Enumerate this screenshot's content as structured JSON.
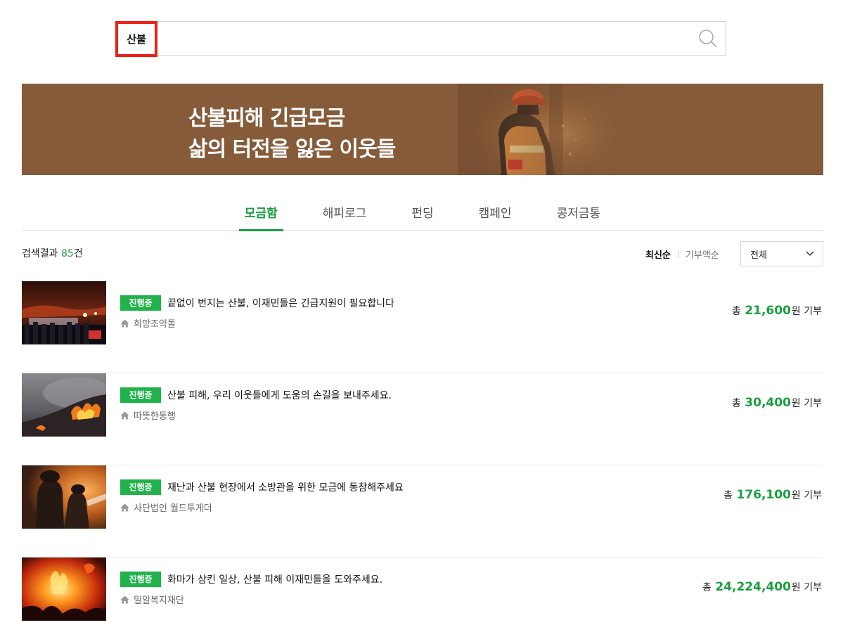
{
  "search": {
    "term": "산불",
    "placeholder": ""
  },
  "banner": {
    "line1": "산불피해 긴급모금",
    "line2": "삶의 터전을 잃은 이웃들"
  },
  "tabs": [
    {
      "label": "모금함",
      "active": true
    },
    {
      "label": "해피로그",
      "active": false
    },
    {
      "label": "펀딩",
      "active": false
    },
    {
      "label": "캠페인",
      "active": false
    },
    {
      "label": "콩저금통",
      "active": false
    }
  ],
  "results": {
    "prefix": "검색결과 ",
    "count": "85",
    "suffix": "건"
  },
  "sort": {
    "latest": "최신순",
    "by_donation": "기부액순"
  },
  "filter": {
    "selected": "전체"
  },
  "items": [
    {
      "status": "진행중",
      "title": "끝없이 번지는 산불, 이재민들은 긴급지원이 필요합니다",
      "org": "희망조약돌",
      "amount_prefix": "총 ",
      "amount": "21,600",
      "amount_suffix": "원 기부"
    },
    {
      "status": "진행중",
      "title": "산불 피해, 우리 이웃들에게 도움의 손길을 보내주세요.",
      "org": "따뜻한동행",
      "amount_prefix": "총 ",
      "amount": "30,400",
      "amount_suffix": "원 기부"
    },
    {
      "status": "진행중",
      "title": "재난과 산불 현장에서 소방관을 위한 모금에 동참해주세요",
      "org": "사단법인 월드투게더",
      "amount_prefix": "총 ",
      "amount": "176,100",
      "amount_suffix": "원 기부"
    },
    {
      "status": "진행중",
      "title": "화마가 삼킨 일상, 산불 피해 이재민들을 도와주세요.",
      "org": "밀알복지재단",
      "amount_prefix": "총 ",
      "amount": "24,224,400",
      "amount_suffix": "원 기부"
    }
  ],
  "colors": {
    "accent_green": "#1a9e3f",
    "badge_green": "#21b24b",
    "highlight_red": "#e8221b",
    "banner_brown": "#855b3a"
  },
  "icons": {
    "search": "magnifier-icon",
    "dropdown": "chevron-down-icon",
    "org": "home-icon"
  }
}
